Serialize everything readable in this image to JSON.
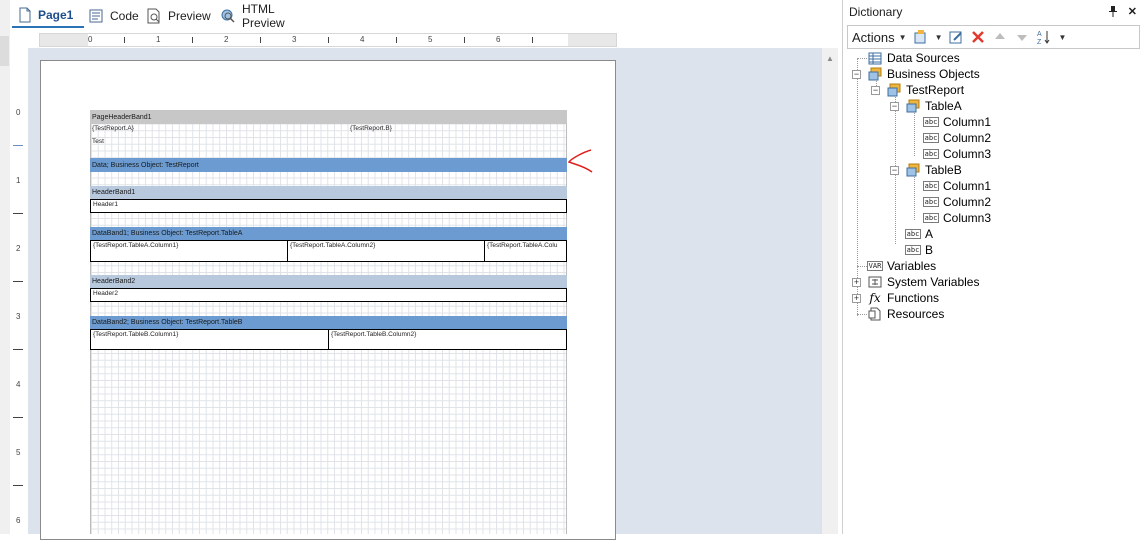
{
  "tabs": [
    {
      "label": "Page1",
      "icon": "page-icon",
      "active": true
    },
    {
      "label": "Code",
      "icon": "code-icon",
      "active": false
    },
    {
      "label": "Preview",
      "icon": "preview-icon",
      "active": false
    },
    {
      "label": "HTML Preview",
      "icon": "html-preview-icon",
      "active": false
    }
  ],
  "ruler": {
    "horizontal": [
      "0",
      "1",
      "2",
      "3",
      "4",
      "5",
      "6"
    ],
    "vertical": [
      "0",
      "1",
      "2",
      "3",
      "4",
      "5",
      "6"
    ]
  },
  "report": {
    "page_header_band": "PageHeaderBand1",
    "cells": {
      "test_report_a": "{TestReport.A}",
      "test_report_b": "{TestReport.B}",
      "test_text": "Test",
      "header1": "Header1",
      "table_a_col1": "{TestReport.TableA.Column1}",
      "table_a_col2": "{TestReport.TableA.Column2}",
      "table_a_col3": "{TestReport.TableA.Colu",
      "header2": "Header2",
      "table_b_col1": "{TestReport.TableB.Column1}",
      "table_b_col2": "{TestReport.TableB.Column2}"
    },
    "data_band": "Data; Business Object: TestReport",
    "header_band1": "HeaderBand1",
    "data_band1": "DataBand1; Business Object: TestReport.TableA",
    "header_band2": "HeaderBand2",
    "data_band2": "DataBand2; Business Object: TestReport.TableB"
  },
  "dictionary": {
    "title": "Dictionary",
    "pin_icon": "pin-icon",
    "close_label": "✕",
    "toolbar": {
      "actions_label": "Actions",
      "icons": [
        "new-item-icon",
        "edit-icon",
        "delete-icon",
        "move-up-icon",
        "move-down-icon",
        "sort-icon"
      ]
    },
    "tree": {
      "data_sources": "Data Sources",
      "business_objects": "Business Objects",
      "test_report": "TestReport",
      "table_a": "TableA",
      "table_a_columns": [
        "Column1",
        "Column2",
        "Column3"
      ],
      "table_b": "TableB",
      "table_b_columns": [
        "Column1",
        "Column2",
        "Column3"
      ],
      "field_a": "A",
      "field_b": "B",
      "variables": "Variables",
      "system_variables": "System Variables",
      "functions": "Functions",
      "resources": "Resources"
    },
    "column_icon_text": "abc",
    "variables_icon_text": "VAR",
    "functions_icon_text": "fx"
  },
  "colors": {
    "data_band": "#6b9bd0",
    "header_band": "#b8c9de",
    "annotation": "#e0201c"
  }
}
